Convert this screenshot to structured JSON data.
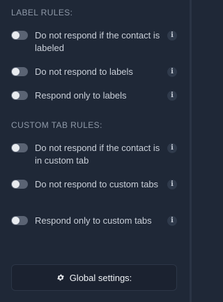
{
  "sections": [
    {
      "title": "LABEL RULES:",
      "rules": [
        {
          "label": "Do not respond if the contact is labeled",
          "enabled": false
        },
        {
          "label": "Do not respond to labels",
          "enabled": false
        },
        {
          "label": "Respond only to labels",
          "enabled": false
        }
      ]
    },
    {
      "title": "CUSTOM TAB RULES:",
      "rules": [
        {
          "label": "Do not respond if the contact is in custom tab",
          "enabled": false
        },
        {
          "label": "Do not respond to custom tabs",
          "enabled": false
        },
        {
          "label": "Respond only to custom tabs",
          "enabled": false
        }
      ]
    }
  ],
  "info_icon_glyph": "i",
  "global_settings": {
    "label": "Global settings:",
    "icon": "gear-icon"
  },
  "colors": {
    "background": "#1f2837",
    "toggle_off": "#5a6373",
    "text": "#c9cfd8",
    "muted": "#8f99a8"
  }
}
